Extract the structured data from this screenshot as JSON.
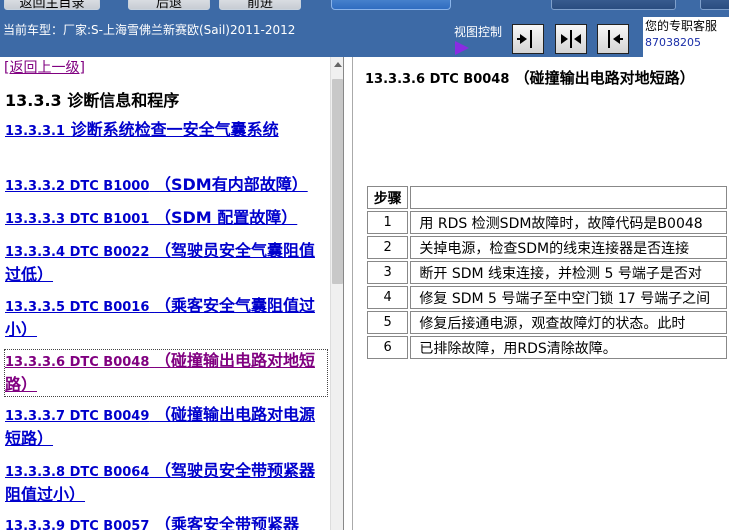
{
  "toolbar": {
    "btn1_label": "返回主目录",
    "btn2_label": "后退",
    "btn3_label": "前进"
  },
  "car_info": "当前车型：厂家:S-上海雪佛兰新赛欧(Sail)2011-2012",
  "view_control": {
    "label": "视图控制",
    "buttons": [
      "right-pane-button",
      "both-panes-button",
      "left-pane-button"
    ]
  },
  "service": {
    "label": "您的专职客服",
    "phone": "87038205"
  },
  "left_pane": {
    "back_link": "[返回上一级]",
    "section_title": "13.3.3 诊断信息和程序",
    "items": [
      {
        "code": "13.3.3.1",
        "text": "诊断系统检查一安全气囊系统"
      },
      {
        "code": "13.3.3.2 DTC B1000",
        "text": "（SDM有内部故障）"
      },
      {
        "code": "13.3.3.3 DTC B1001",
        "text": "（SDM 配置故障）"
      },
      {
        "code": "13.3.3.4 DTC B0022",
        "text": "（驾驶员安全气囊阻值过低）"
      },
      {
        "code": "13.3.3.5 DTC B0016",
        "text": "（乘客安全气囊阻值过小）"
      },
      {
        "code": "13.3.3.6 DTC B0048",
        "text": "（碰撞输出电路对地短路）"
      },
      {
        "code": "13.3.3.7 DTC B0049",
        "text": "（碰撞输出电路对电源短路）"
      },
      {
        "code": "13.3.3.8 DTC B0064",
        "text": "（驾驶员安全带预紧器阻值过小）"
      },
      {
        "code": "13.3.3.9 DTC B0057",
        "text": "（乘客安全带预紧器"
      }
    ]
  },
  "right_pane": {
    "title_code": "13.3.3.6 DTC B0048",
    "title_text": "（碰撞输出电路对地短路）",
    "table_header": "步骤",
    "steps": [
      {
        "num": "1",
        "text": "用 RDS 检测SDM故障时，故障代码是B0048"
      },
      {
        "num": "2",
        "text": "关掉电源，检查SDM的线束连接器是否连接"
      },
      {
        "num": "3",
        "text": "断开 SDM 线束连接，并检测 5 号端子是否对"
      },
      {
        "num": "4",
        "text": "修复 SDM 5 号端子至中空门锁 17 号端子之间"
      },
      {
        "num": "5",
        "text": "修复后接通电源，观查故障灯的状态。此时"
      },
      {
        "num": "6",
        "text": "已排除故障，用RDS清除故障。"
      }
    ]
  }
}
